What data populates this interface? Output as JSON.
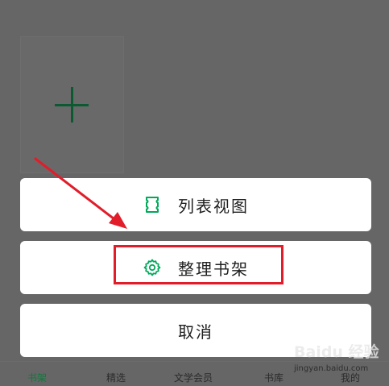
{
  "shelf": {
    "add_card_icon": "plus-icon"
  },
  "action_sheet": {
    "list_view_label": "列表视图",
    "list_view_icon": "list-view-icon",
    "organize_label": "整理书架",
    "organize_icon": "gear-icon",
    "cancel_label": "取消",
    "accent_color": "#00a85a"
  },
  "tabs": [
    {
      "label": "书架",
      "active": true
    },
    {
      "label": "精选",
      "active": false
    },
    {
      "label": "文学会员",
      "active": false
    },
    {
      "label": "书库",
      "active": false
    },
    {
      "label": "我的",
      "active": false
    }
  ],
  "annotation": {
    "highlight_color": "#e11d2a"
  },
  "watermark": {
    "logo": "Baidu 经验",
    "url": "jingyan.baidu.com"
  }
}
